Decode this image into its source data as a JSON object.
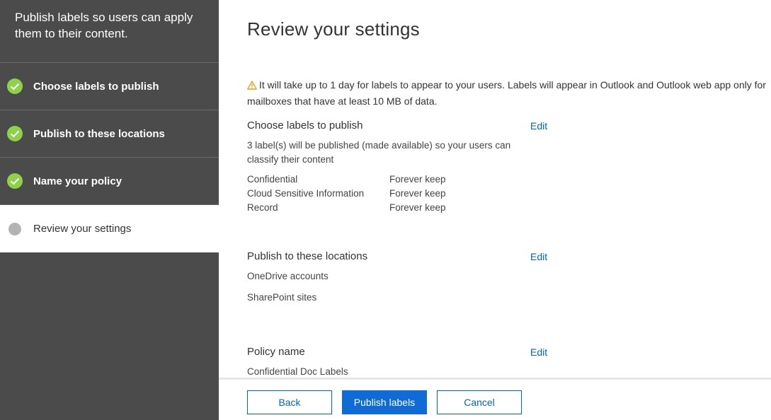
{
  "sidebar": {
    "header": "Publish labels so users can apply them to their content.",
    "steps": [
      {
        "label": "Choose labels to publish",
        "state": "completed"
      },
      {
        "label": "Publish to these locations",
        "state": "completed"
      },
      {
        "label": "Name your policy",
        "state": "completed"
      },
      {
        "label": "Review your settings",
        "state": "current"
      }
    ]
  },
  "main": {
    "title": "Review your settings",
    "warning": "It will take up to 1 day for labels to appear to your users. Labels will appear in Outlook and Outlook web app only for mailboxes that have at least 10 MB of data.",
    "sections": {
      "labels": {
        "title": "Choose labels to publish",
        "edit": "Edit",
        "description": "3 label(s) will be published (made available) so your users can classify their content",
        "items": [
          {
            "name": "Confidential",
            "retention": "Forever keep"
          },
          {
            "name": "Cloud Sensitive Information",
            "retention": "Forever keep"
          },
          {
            "name": "Record",
            "retention": "Forever keep"
          }
        ]
      },
      "locations": {
        "title": "Publish to these locations",
        "edit": "Edit",
        "items": [
          "OneDrive accounts",
          "SharePoint sites"
        ]
      },
      "policy": {
        "title": "Policy name",
        "edit": "Edit",
        "value": "Confidential Doc Labels"
      }
    }
  },
  "footer": {
    "back": "Back",
    "publish": "Publish labels",
    "cancel": "Cancel"
  },
  "colors": {
    "sidebar_bg": "#4b4b4b",
    "check_green": "#8ed14a",
    "link_blue": "#0066b8",
    "primary_button": "#0f6cd6",
    "warning_icon": "#e8a317"
  },
  "icons": {
    "completed_step": "check-circle-icon",
    "current_step": "circle-dot-icon",
    "warning": "warning-triangle-icon"
  }
}
